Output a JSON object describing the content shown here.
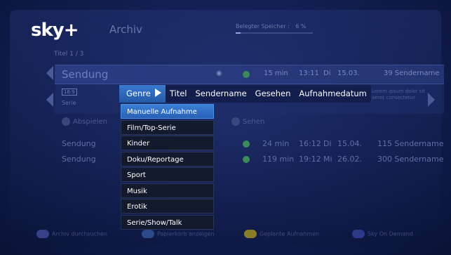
{
  "header": {
    "logo": "sky+",
    "title": "Archiv",
    "storage_label": "Belegter Speicher :",
    "storage_value": "6 %",
    "title_count": "Titel 1 / 3"
  },
  "list": {
    "selected": {
      "name": "Sendung",
      "duration": "15 min",
      "time": "13:11",
      "day": "Di",
      "date": "15.03.",
      "channel": "39 Sendername"
    },
    "details": {
      "format_tag": "16:9",
      "category": "Serie",
      "description": "Lorem ipsum dolor sit amet consectetur"
    },
    "actions": {
      "watch": "Abspielen",
      "view": "Sehen"
    },
    "rows": [
      {
        "name": "Sendung",
        "duration": "24 min",
        "time": "16:12",
        "day": "Di",
        "date": "15.04.",
        "channel": "115 Sendername"
      },
      {
        "name": "Sendung",
        "duration": "119 min",
        "time": "19:12",
        "day": "Mi",
        "date": "26.02.",
        "channel": "300 Sendername"
      }
    ]
  },
  "filter_bar": {
    "items": [
      "Genre",
      "Titel",
      "Sendername",
      "Gesehen",
      "Aufnahmedatum"
    ]
  },
  "dropdown": {
    "items": [
      "Manuelle Aufnahme",
      "Film/Top-Serie",
      "Kinder",
      "Doku/Reportage",
      "Sport",
      "Musik",
      "Erotik",
      "Serie/Show/Talk"
    ]
  },
  "footer": {
    "buttons": [
      {
        "label": "Archiv durchsuchen",
        "color": "#3a3f8a"
      },
      {
        "label": "Papierkorb anzeigen",
        "color": "#2c4a8a"
      },
      {
        "label": "Geplante Aufnahmen",
        "color": "#8a7d2a"
      },
      {
        "label": "Sky On Demand",
        "color": "#2d3a8a"
      }
    ]
  },
  "colors": {
    "accent": "#2f6fc6",
    "background": "#142055"
  }
}
